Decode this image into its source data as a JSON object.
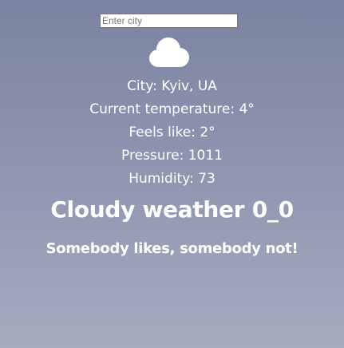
{
  "search": {
    "placeholder": "Enter city",
    "value": ""
  },
  "weather": {
    "icon": "cloud-icon",
    "city_line": "City: Kyiv, UA",
    "temperature_line": "Current temperature: 4°",
    "feels_like_line": "Feels like: 2°",
    "pressure_line": "Pressure: 1011",
    "humidity_line": "Humidity: 73",
    "headline": "Cloudy weather 0_0",
    "tagline": "Somebody likes, somebody not!"
  },
  "colors": {
    "background_top": "#7a83a1",
    "background_bottom": "#a6abbf",
    "text": "#ffffff"
  }
}
